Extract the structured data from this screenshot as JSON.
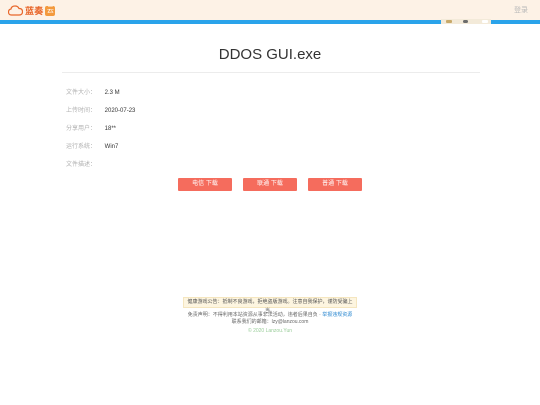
{
  "header": {
    "logo_text": "蓝奏",
    "logo_badge": "云",
    "login_label": "登录"
  },
  "file": {
    "title": "DDOS GUI.exe",
    "info": [
      {
        "label": "文件大小：",
        "value": "2.3 M"
      },
      {
        "label": "上传时间：",
        "value": "2020-07-23"
      },
      {
        "label": "分享用户：",
        "value": "18**"
      },
      {
        "label": "运行系统：",
        "value": "Win7"
      },
      {
        "label": "文件描述：",
        "value": ""
      }
    ]
  },
  "downloads": [
    {
      "label": "电信 下载"
    },
    {
      "label": "联通 下载"
    },
    {
      "label": "普通 下载"
    }
  ],
  "footer": {
    "notice": "健康游戏公告：抵制不良游戏，拒绝盗版游戏。注意自我保护，谨防受骗上当。",
    "disclaimer_text": "免责声明：不得利用本站资源从事非法活动，违者后果自负 · ",
    "disclaimer_link": "举报违规资源",
    "contact": "联系我们的邮箱：lzy@lanzou.com",
    "copyright": "© 2020 Lanzou.Yun"
  },
  "colors": {
    "accent": "#2aa3ea",
    "download_button": "#f56c5d",
    "logo": "#e8672b",
    "topbar_bg": "#fdf2e6"
  }
}
